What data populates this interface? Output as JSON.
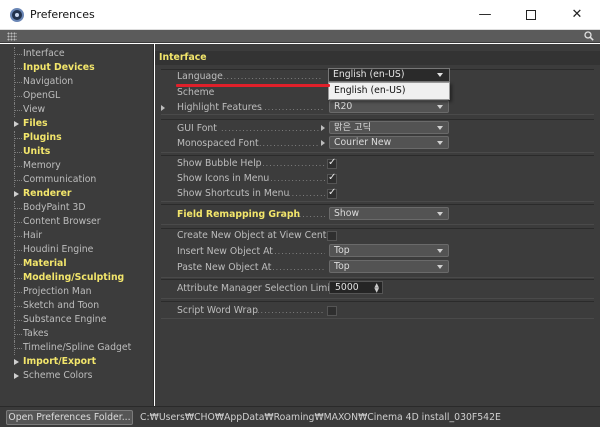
{
  "window": {
    "title": "Preferences",
    "minimize_glyph": "—",
    "close_glyph": "✕"
  },
  "sidebar": {
    "items": [
      {
        "label": "Interface",
        "style": "selected"
      },
      {
        "label": "Input Devices",
        "style": "bold"
      },
      {
        "label": "Navigation",
        "style": "normal"
      },
      {
        "label": "OpenGL",
        "style": "normal"
      },
      {
        "label": "View",
        "style": "normal"
      },
      {
        "label": "Files",
        "style": "bold",
        "expandable": true
      },
      {
        "label": "Plugins",
        "style": "bold"
      },
      {
        "label": "Units",
        "style": "bold"
      },
      {
        "label": "Memory",
        "style": "normal"
      },
      {
        "label": "Communication",
        "style": "normal"
      },
      {
        "label": "Renderer",
        "style": "bold",
        "expandable": true
      },
      {
        "label": "BodyPaint 3D",
        "style": "normal"
      },
      {
        "label": "Content Browser",
        "style": "normal"
      },
      {
        "label": "Hair",
        "style": "normal"
      },
      {
        "label": "Houdini Engine",
        "style": "normal"
      },
      {
        "label": "Material",
        "style": "bold"
      },
      {
        "label": "Modeling/Sculpting",
        "style": "bold"
      },
      {
        "label": "Projection Man",
        "style": "normal"
      },
      {
        "label": "Sketch and Toon",
        "style": "normal"
      },
      {
        "label": "Substance Engine",
        "style": "normal"
      },
      {
        "label": "Takes",
        "style": "normal"
      },
      {
        "label": "Timeline/Spline Gadget",
        "style": "normal"
      },
      {
        "label": "Import/Export",
        "style": "bold",
        "expandable": true
      },
      {
        "label": "Scheme Colors",
        "style": "normal",
        "expandable": true
      }
    ]
  },
  "main": {
    "header": "Interface",
    "language": {
      "label": "Language",
      "value": "English (en-US)",
      "option": "English (en-US)"
    },
    "scheme": {
      "label": "Scheme"
    },
    "highlight_features": {
      "label": "Highlight Features",
      "value": "R20"
    },
    "gui_font": {
      "label": "GUI Font",
      "value": "맑은 고딕"
    },
    "mono_font": {
      "label": "Monospaced Font",
      "value": "Courier New"
    },
    "show_bubble_help": {
      "label": "Show Bubble Help",
      "checked": true
    },
    "show_icons_menu": {
      "label": "Show Icons in Menu",
      "checked": true
    },
    "show_shortcuts_menu": {
      "label": "Show Shortcuts in Menu",
      "checked": true
    },
    "field_remapping": {
      "label": "Field Remapping Graph",
      "value": "Show"
    },
    "create_at_view_center": {
      "label": "Create New Object at View Center",
      "checked": false
    },
    "insert_new_object": {
      "label": "Insert New Object At",
      "value": "Top"
    },
    "paste_new_object": {
      "label": "Paste New Object At",
      "value": "Top"
    },
    "attr_selection_limit": {
      "label": "Attribute Manager Selection Limit",
      "value": "5000"
    },
    "script_word_wrap": {
      "label": "Script Word Wrap",
      "checked": false
    }
  },
  "bottom": {
    "open_folder_button": "Open Preferences Folder...",
    "path": "C:₩Users₩CHO₩AppData₩Roaming₩MAXON₩Cinema 4D install_030F542E"
  },
  "colors": {
    "accent_bold": "#f3e66b",
    "selected": "#f5a623",
    "annotation_red": "#e0202a",
    "panel_bg": "#3c3c3c"
  },
  "icons": [
    "cinema4d-app-icon",
    "grip-icon",
    "search-icon",
    "chevron-down-icon",
    "checkmark-icon",
    "expand-arrow-icon"
  ]
}
